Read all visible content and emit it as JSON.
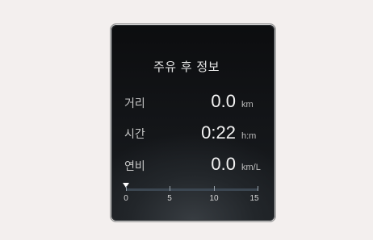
{
  "panel": {
    "title": "주유 후 정보",
    "rows": [
      {
        "label": "거리",
        "value": "0.0",
        "unit": "km"
      },
      {
        "label": "시간",
        "value": "0:22",
        "unit": "h:m"
      },
      {
        "label": "연비",
        "value": "0.0",
        "unit": "km/L"
      }
    ],
    "gauge": {
      "ticks": [
        "0",
        "5",
        "10",
        "15"
      ],
      "pointer_value": 0,
      "max": 15
    }
  },
  "colors": {
    "page_background": "#f3efee",
    "panel_background": "#131518",
    "text": "#f2f2f2"
  }
}
